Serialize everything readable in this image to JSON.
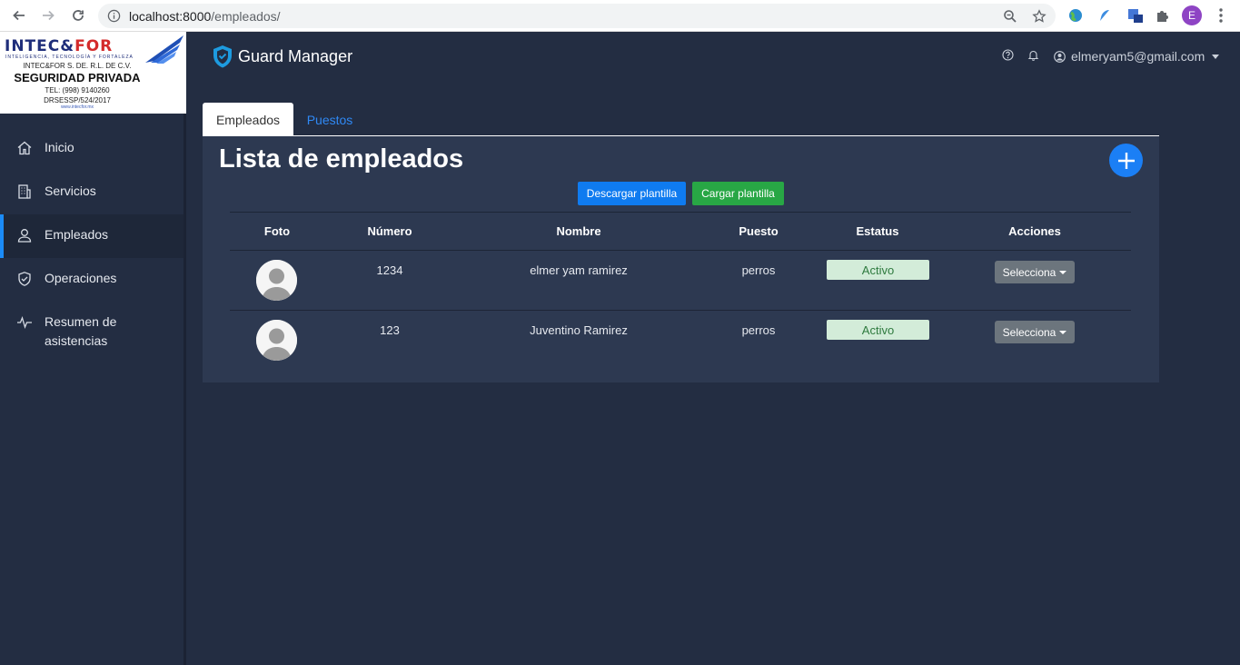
{
  "browser": {
    "url_host": "localhost:8000",
    "url_path": "/empleados/",
    "profile_initial": "E"
  },
  "logo": {
    "top_left": "INTEC&",
    "top_right": "FOR",
    "tagline": "INTELIGENCIA, TECNOLOGÍA Y FORTALEZA",
    "company": "INTEC&FOR S. DE. R.L. DE C.V.",
    "title": "SEGURIDAD PRIVADA",
    "phone": "TEL: (998) 9140260",
    "permit": "DRSESSP/524/2017",
    "website": "www.intecfor.mx"
  },
  "sidebar": {
    "items": [
      {
        "label": "Inicio",
        "icon": "home-icon"
      },
      {
        "label": "Servicios",
        "icon": "building-icon"
      },
      {
        "label": "Empleados",
        "icon": "user-icon",
        "active": true
      },
      {
        "label": "Operaciones",
        "icon": "shield-icon"
      },
      {
        "label": "Resumen de asistencias",
        "icon": "pulse-icon"
      }
    ]
  },
  "header": {
    "brand": "Guard Manager",
    "user_email": "elmeryam5@gmail.com"
  },
  "tabs": [
    {
      "label": "Empleados",
      "active": true
    },
    {
      "label": "Puestos",
      "active": false
    }
  ],
  "main": {
    "title": "Lista de empleados",
    "download_label": "Descargar plantilla",
    "upload_label": "Cargar plantilla",
    "columns": [
      "Foto",
      "Número",
      "Nombre",
      "Puesto",
      "Estatus",
      "Acciones"
    ],
    "rows": [
      {
        "numero": "1234",
        "nombre": "elmer yam ramirez",
        "puesto": "perros",
        "estatus": "Activo",
        "accion": "Selecciona"
      },
      {
        "numero": "123",
        "nombre": "Juventino Ramirez",
        "puesto": "perros",
        "estatus": "Activo",
        "accion": "Selecciona"
      }
    ]
  },
  "colors": {
    "background": "#232d42",
    "card": "#2d3951",
    "primary": "#0f7bf0",
    "success": "#28a745",
    "status_bg": "#d3ecd9"
  }
}
